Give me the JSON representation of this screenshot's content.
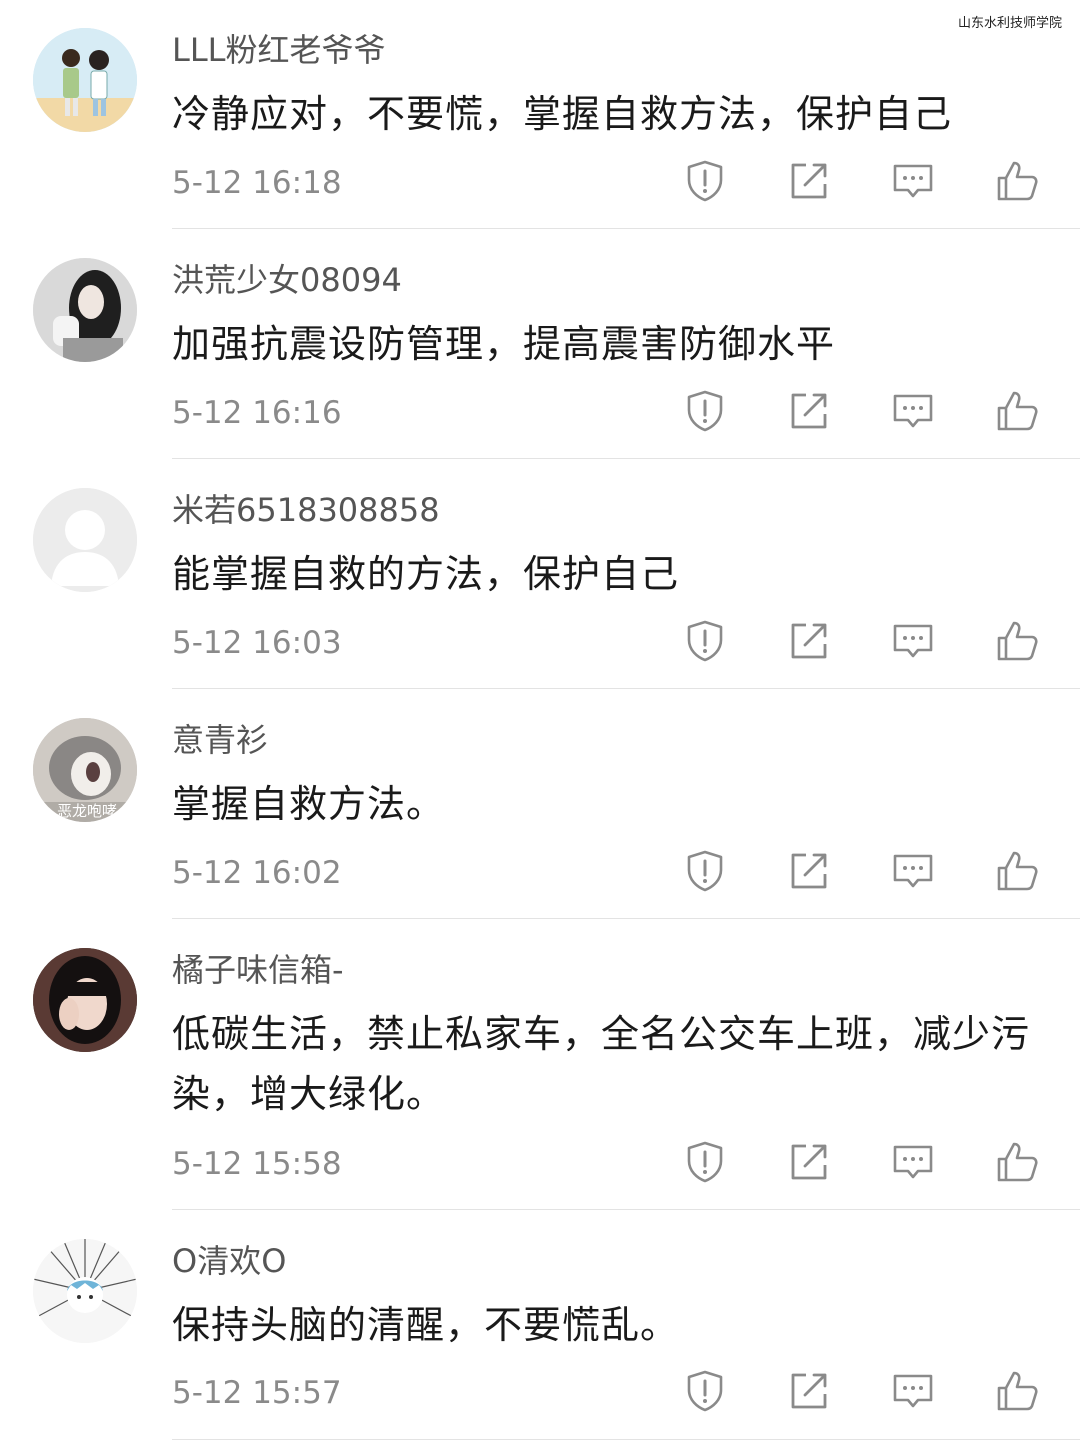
{
  "watermark": "山东水利技师学院",
  "comments": [
    {
      "username": "LLL粉红老爷爷",
      "content": "冷静应对，不要慌，掌握自救方法，保护自己",
      "time": "5-12 16:18",
      "avatar": "cartoon-couple-avatar"
    },
    {
      "username": "洪荒少女08094",
      "content": "加强抗震设防管理，提高震害防御水平",
      "time": "5-12 16:16",
      "avatar": "girl-photo-avatar"
    },
    {
      "username": "米若6518308858",
      "content": "能掌握自救的方法，保护自己",
      "time": "5-12 16:03",
      "avatar": "default-user-avatar"
    },
    {
      "username": "意青衫",
      "content": "掌握自救方法。",
      "time": "5-12 16:02",
      "avatar": "cat-photo-avatar",
      "avatar_caption": "恶龙咆哮"
    },
    {
      "username": "橘子味信箱-",
      "content": "低碳生活，禁止私家车，全名公交车上班，减少污染，增大绿化。",
      "time": "5-12 15:58",
      "avatar": "girl-selfie-avatar"
    },
    {
      "username": "O清欢O",
      "content": "保持头脑的清醒，不要慌乱。",
      "time": "5-12 15:57",
      "avatar": "anime-sketch-avatar"
    }
  ],
  "actions": [
    "report-icon",
    "share-icon",
    "reply-icon",
    "like-icon"
  ],
  "colors": {
    "text": "#1a1a1a",
    "username": "#555555",
    "time": "#8a8a8a",
    "icon": "#8a8a8a",
    "divider": "#e3e3e3"
  }
}
